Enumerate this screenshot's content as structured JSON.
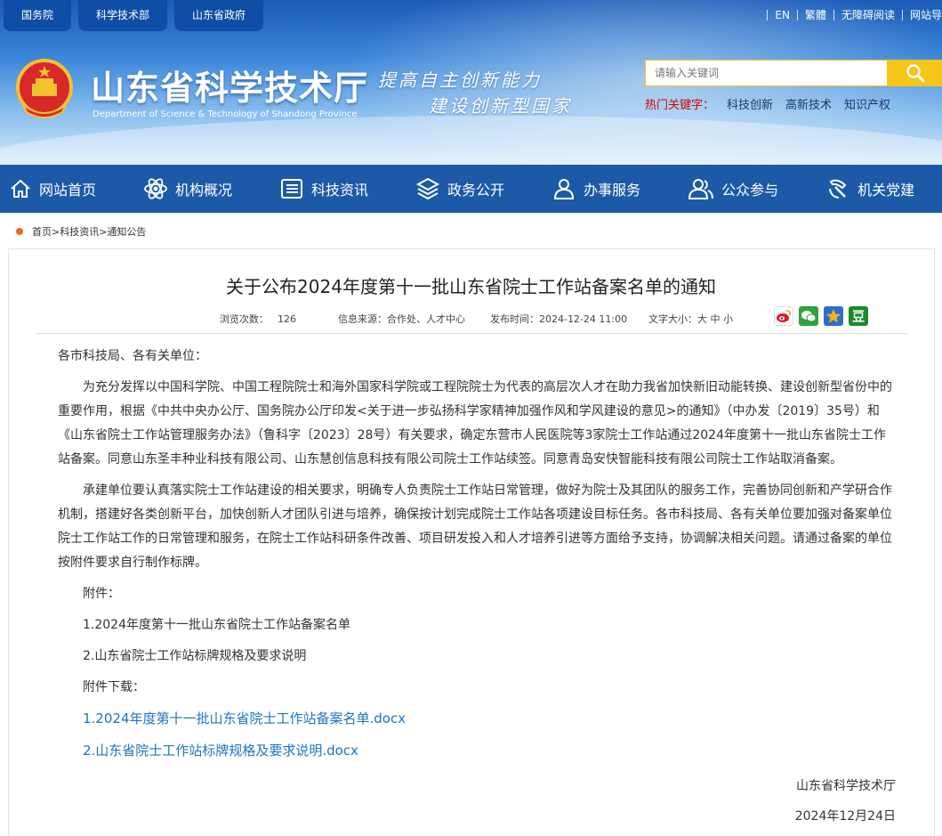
{
  "header": {
    "top_links": [
      "国务院",
      "科学技术部",
      "山东省政府"
    ],
    "util_links": [
      "EN",
      "繁體",
      "无障碍阅读",
      "网站导"
    ],
    "site_title": "山东省科学技术厅",
    "site_subtitle": "Department of Science & Technology of Shandong Province",
    "slogan_line1": "提高自主创新能力",
    "slogan_line2": "建设创新型国家",
    "search_placeholder": "请输入关键词",
    "hot_label": "热门关键字：",
    "hot_words": [
      "科技创新",
      "高新技术",
      "知识产权"
    ]
  },
  "nav": [
    {
      "label": "网站首页",
      "icon": "home-icon"
    },
    {
      "label": "机构概况",
      "icon": "atom-icon"
    },
    {
      "label": "科技资讯",
      "icon": "news-icon"
    },
    {
      "label": "政务公开",
      "icon": "layers-icon"
    },
    {
      "label": "办事服务",
      "icon": "user-service-icon"
    },
    {
      "label": "公众参与",
      "icon": "people-icon"
    },
    {
      "label": "机关党建",
      "icon": "party-icon"
    }
  ],
  "breadcrumb": "首页>科技资讯>通知公告",
  "article": {
    "title": "关于公布2024年度第十一批山东省院士工作站备案名单的通知",
    "views_label": "浏览次数：",
    "views": "126",
    "source_label": "信息来源：",
    "source": "合作处、人才中心",
    "date_label": "发布时间：",
    "date": "2024-12-24 11:00",
    "fontsize_label": "文字大小：",
    "fontsize_options": "大 中 小",
    "salutation": "各市科技局、各有关单位：",
    "para1": "为充分发挥以中国科学院、中国工程院院士和海外国家科学院或工程院院士为代表的高层次人才在助力我省加快新旧动能转换、建设创新型省份中的重要作用，根据《中共中央办公厅、国务院办公厅印发<关于进一步弘扬科学家精神加强作风和学风建设的意见>的通知》（中办发〔2019〕35号）和《山东省院士工作站管理服务办法》（鲁科字〔2023〕28号）有关要求，确定东营市人民医院等3家院士工作站通过2024年度第十一批山东省院士工作站备案。同意山东圣丰种业科技有限公司、山东慧创信息科技有限公司院士工作站续签。同意青岛安快智能科技有限公司院士工作站取消备案。",
    "para2": "承建单位要认真落实院士工作站建设的相关要求，明确专人负责院士工作站日常管理，做好为院士及其团队的服务工作，完善协同创新和产学研合作机制，搭建好各类创新平台，加快创新人才团队引进与培养，确保按计划完成院士工作站各项建设目标任务。各市科技局、各有关单位要加强对备案单位院士工作站工作的日常管理和服务，在院士工作站科研条件改善、项目研发投入和人才培养引进等方面给予支持，协调解决相关问题。请通过备案的单位按附件要求自行制作标牌。",
    "attach_label": "附件：",
    "attach1": "1.2024年度第十一批山东省院士工作站备案名单",
    "attach2": "2.山东省院士工作站标牌规格及要求说明",
    "download_label": "附件下载：",
    "download1": "1.2024年度第十一批山东省院士工作站备案名单.docx",
    "download2": "2.山东省院士工作站标牌规格及要求说明.docx",
    "signature": "山东省科学技术厅",
    "sign_date": "2024年12月24日"
  },
  "share": [
    {
      "name": "weibo-icon",
      "color": "#e6162d"
    },
    {
      "name": "wechat-icon",
      "color": "#2fa33d"
    },
    {
      "name": "qzone-icon",
      "color": "#f2b01e"
    },
    {
      "name": "douban-icon",
      "color": "#1a8b2d"
    }
  ]
}
